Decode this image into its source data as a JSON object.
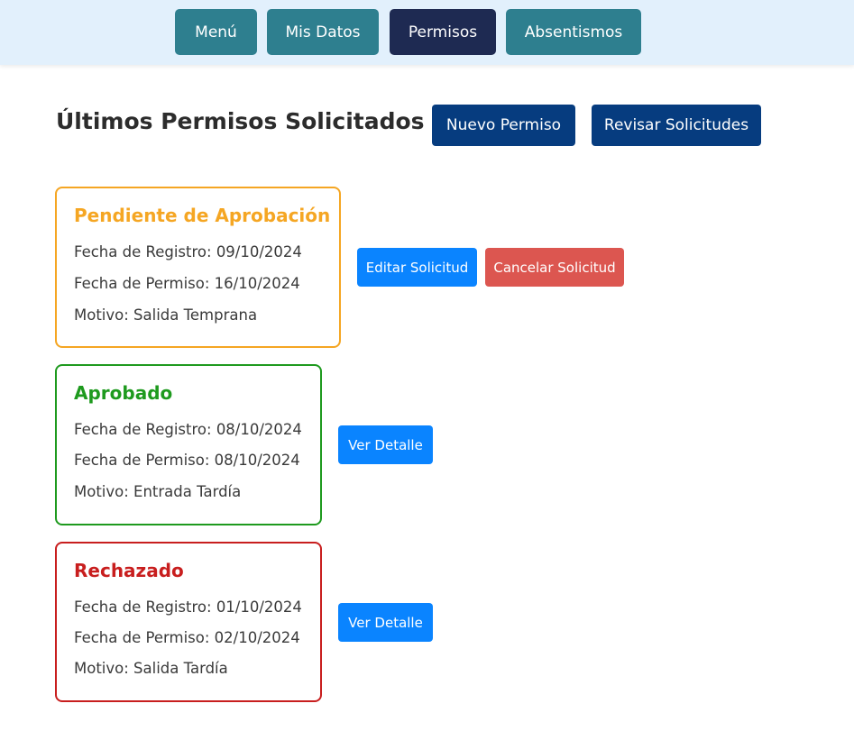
{
  "nav": {
    "items": [
      {
        "label": "Menú"
      },
      {
        "label": "Mis Datos"
      },
      {
        "label": "Permisos",
        "active": true
      },
      {
        "label": "Absentismos"
      }
    ]
  },
  "page": {
    "title": "Últimos Permisos Solicitados",
    "new_button": "Nuevo Permiso",
    "review_button": "Revisar Solicitudes"
  },
  "cards": [
    {
      "status": "Pendiente de Aprobación",
      "color": "#f5a623",
      "registro": "Fecha de Registro: 09/10/2024",
      "permiso": "Fecha de Permiso: 16/10/2024",
      "motivo": "Motivo: Salida Temprana",
      "actions": [
        "Editar Solicitud",
        "Cancelar Solicitud"
      ]
    },
    {
      "status": "Aprobado",
      "color": "#1e9a1e",
      "registro": "Fecha de Registro: 08/10/2024",
      "permiso": "Fecha de Permiso: 08/10/2024",
      "motivo": "Motivo: Entrada Tardía",
      "actions": [
        "Ver Detalle"
      ]
    },
    {
      "status": "Rechazado",
      "color": "#c81e1e",
      "registro": "Fecha de Registro: 01/10/2024",
      "permiso": "Fecha de Permiso: 02/10/2024",
      "motivo": "Motivo: Salida Tardía",
      "actions": [
        "Ver Detalle"
      ]
    }
  ],
  "colors": {
    "nav_teal": "#2e7f8f",
    "nav_active": "#1e2a52",
    "header_button": "#063c7f",
    "action_blue": "#0a84ff",
    "action_red": "#dc5650"
  }
}
